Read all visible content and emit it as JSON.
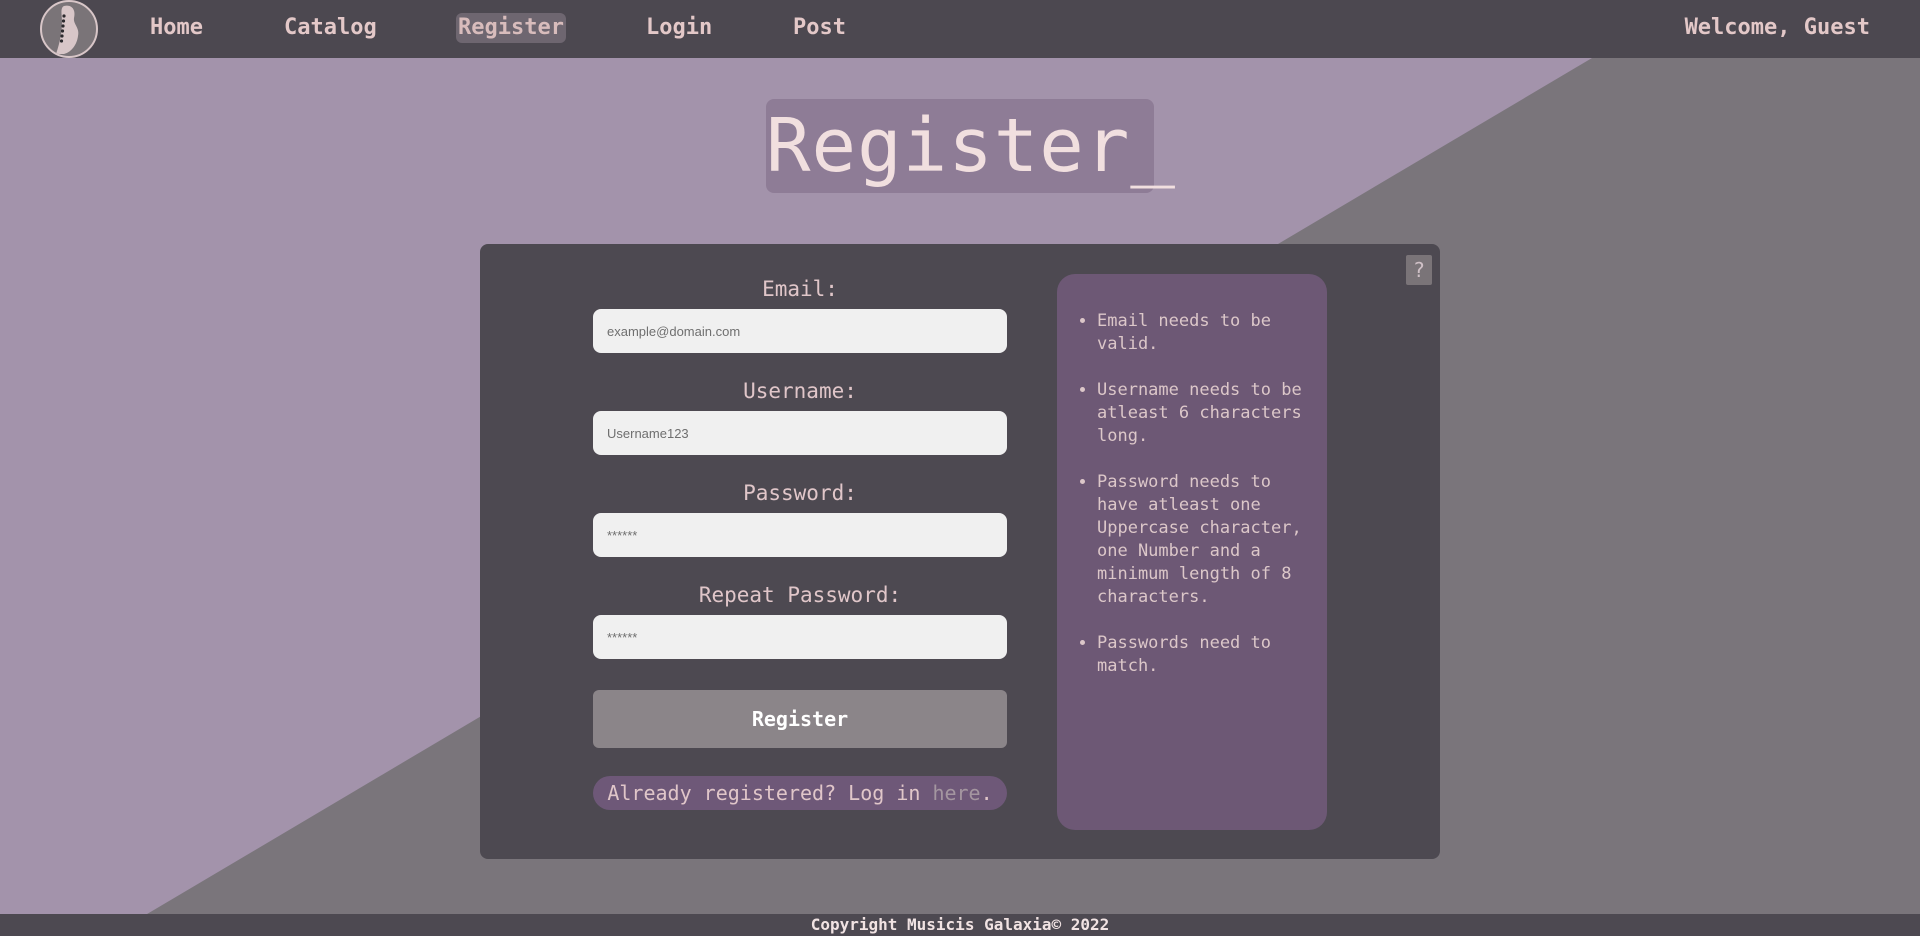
{
  "nav": {
    "links": [
      {
        "label": "Home"
      },
      {
        "label": "Catalog"
      },
      {
        "label": "Register"
      },
      {
        "label": "Login"
      },
      {
        "label": "Post"
      }
    ],
    "welcome": "Welcome, Guest"
  },
  "page_title": "Register_",
  "form": {
    "help_label": "?",
    "email": {
      "label": "Email:",
      "placeholder": "example@domain.com",
      "value": ""
    },
    "username": {
      "label": "Username:",
      "placeholder": "Username123",
      "value": ""
    },
    "password": {
      "label": "Password:",
      "placeholder": "******",
      "value": ""
    },
    "repeat_password": {
      "label": "Repeat Password:",
      "placeholder": "******",
      "value": ""
    },
    "submit_label": "Register",
    "login_hint_prefix": "Already registered? Log in ",
    "login_hint_link": "here",
    "login_hint_suffix": "."
  },
  "rules": [
    "Email needs to be valid.",
    "Username needs to be atleast 6 characters long.",
    "Password needs to have atleast one Uppercase character, one Number and a minimum length of 8 characters.",
    "Passwords need to match."
  ],
  "footer": "Copyright Musicis Galaxia© 2022",
  "colors": {
    "nav_bg": "#4c4850",
    "bg_light": "#a393ab",
    "bg_dark": "#7a757b",
    "card_bg": "#4d4951",
    "accent": "#6d5875",
    "text": "#e3c8c8"
  }
}
